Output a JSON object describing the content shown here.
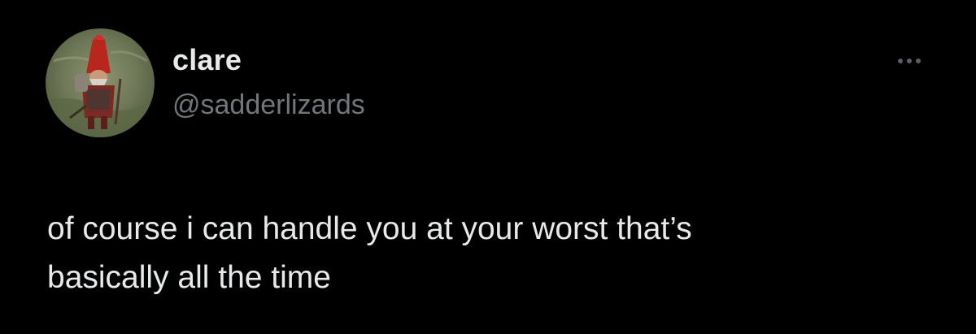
{
  "user": {
    "display_name": "clare",
    "handle": "@sadderlizards"
  },
  "tweet": {
    "text": "of course i can handle you at your worst that’s\nbasically all the time"
  },
  "icons": {
    "avatar": "gnome-avatar",
    "more": "more-horizontal-icon"
  },
  "colors": {
    "background": "#000000",
    "text_primary": "#e7e9ea",
    "text_secondary": "#71767b"
  }
}
